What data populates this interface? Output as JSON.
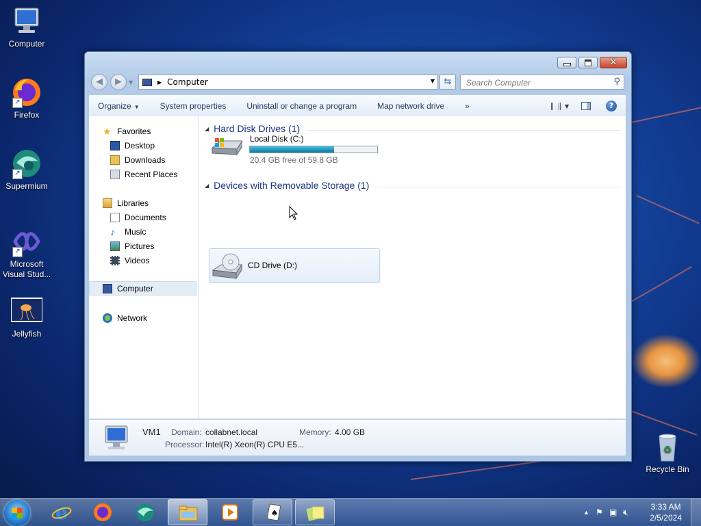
{
  "desktop": {
    "icons": [
      {
        "label": "Computer"
      },
      {
        "label": "Firefox"
      },
      {
        "label": "Supermium"
      },
      {
        "label": "Microsoft Visual Stud..."
      },
      {
        "label": "Jellyfish"
      },
      {
        "label": "Recycle Bin"
      }
    ]
  },
  "window": {
    "address": {
      "location": "Computer"
    },
    "search": {
      "placeholder": "Search Computer"
    },
    "toolbar": {
      "organize": "Organize",
      "system_properties": "System properties",
      "uninstall": "Uninstall or change a program",
      "map_drive": "Map network drive",
      "more": "»"
    },
    "nav": {
      "favorites": "Favorites",
      "desktop": "Desktop",
      "downloads": "Downloads",
      "recent": "Recent Places",
      "libraries": "Libraries",
      "documents": "Documents",
      "music": "Music",
      "pictures": "Pictures",
      "videos": "Videos",
      "computer": "Computer",
      "network": "Network"
    },
    "groups": {
      "hdd": {
        "title": "Hard Disk Drives (1)",
        "drive_name": "Local Disk (C:)",
        "free_text": "20.4 GB free of 59.8 GB",
        "used_fraction": 0.66
      },
      "removable": {
        "title": "Devices with Removable Storage (1)",
        "drive_name": "CD Drive (D:)"
      }
    },
    "details": {
      "name": "VM1",
      "domain_label": "Domain:",
      "domain_value": "collabnet.local",
      "memory_label": "Memory:",
      "memory_value": "4.00 GB",
      "processor_label": "Processor:",
      "processor_value": "Intel(R) Xeon(R) CPU E5..."
    }
  },
  "taskbar": {
    "clock_time": "3:33 AM",
    "clock_date": "2/5/2024"
  }
}
